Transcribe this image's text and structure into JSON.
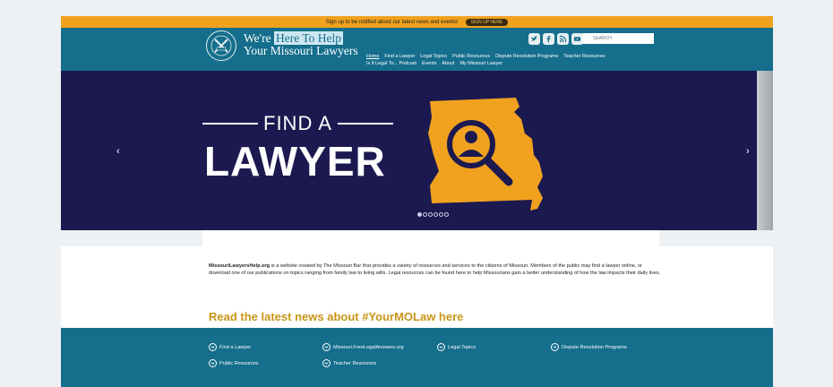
{
  "topbar": {
    "message": "Sign up to be notified about our latest news and events!",
    "button_label": "SIGN UP HERE"
  },
  "header": {
    "brand_line1_prefix": "We're",
    "brand_line1_highlight": "Here To Help",
    "brand_line2": "Your Missouri Lawyers",
    "logo_icon": "missouri-bar-seal",
    "social_icons": [
      "twitter-icon",
      "facebook-icon",
      "rss-icon",
      "youtube-icon"
    ],
    "search_placeholder": "SEARCH"
  },
  "nav": {
    "row1": [
      "Home",
      "Find a Lawyer",
      "Legal Topics",
      "Public Resources",
      "Dispute Resolution Programs",
      "Teacher Resources"
    ],
    "row2": [
      "Is It Legal To... Podcast",
      "Events",
      "About",
      "My Missouri Lawyer"
    ]
  },
  "hero": {
    "line1": "FIND A",
    "line2": "LAWYER",
    "prev_icon": "chevron-left-icon",
    "next_icon": "chevron-right-icon",
    "slide_count": 6,
    "active_slide": 1,
    "colors": {
      "bg": "#1c1950",
      "map": "#f0a21f"
    }
  },
  "intro": {
    "site": "MissouriLawyersHelp.org",
    "text": " is a website created by The Missouri Bar that provides a variety of resources and services to the citizens of Missouri. Members of the public may find a lawyer online, or download one of our publications on topics ranging from family law to living wills. Legal resources can be found here to help Missourians gain a better understanding of how the law impacts their daily lives."
  },
  "news": {
    "link": "Read the latest news about #YourMOLaw here"
  },
  "footer": {
    "links": [
      "Find a Lawyer",
      "Missouri.FreeLegalAnswers.org",
      "Legal Topics",
      "Dispute Resolution Programs",
      "Public Resources",
      "Teacher Resources"
    ]
  },
  "colors": {
    "brand": "#156e8c",
    "accent": "#f0a21f",
    "news": "#c9951a"
  }
}
